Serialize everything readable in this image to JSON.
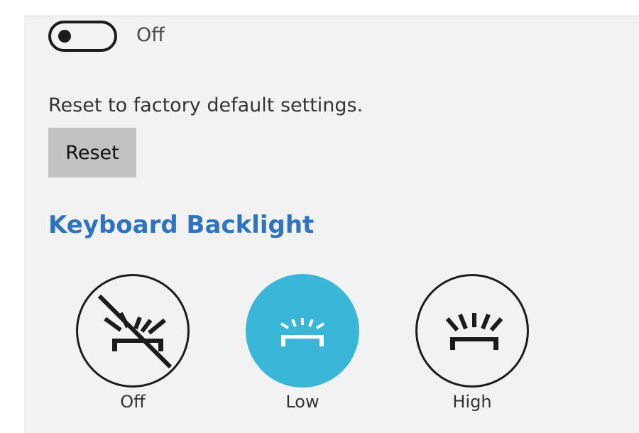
{
  "toggle": {
    "state_label": "Off",
    "is_on": false
  },
  "reset": {
    "description": "Reset to factory default settings.",
    "button_label": "Reset"
  },
  "keyboard_backlight": {
    "title": "Keyboard Backlight",
    "selected": "Low",
    "options": [
      {
        "label": "Off",
        "icon": "keyboard-backlight-off-icon"
      },
      {
        "label": "Low",
        "icon": "keyboard-backlight-low-icon"
      },
      {
        "label": "High",
        "icon": "keyboard-backlight-high-icon"
      }
    ]
  },
  "colors": {
    "accent_heading": "#2e74c0",
    "selected_option": "#3ab7d8",
    "reset_button": "#c2c2c2",
    "panel_background": "#f2f2f2"
  }
}
